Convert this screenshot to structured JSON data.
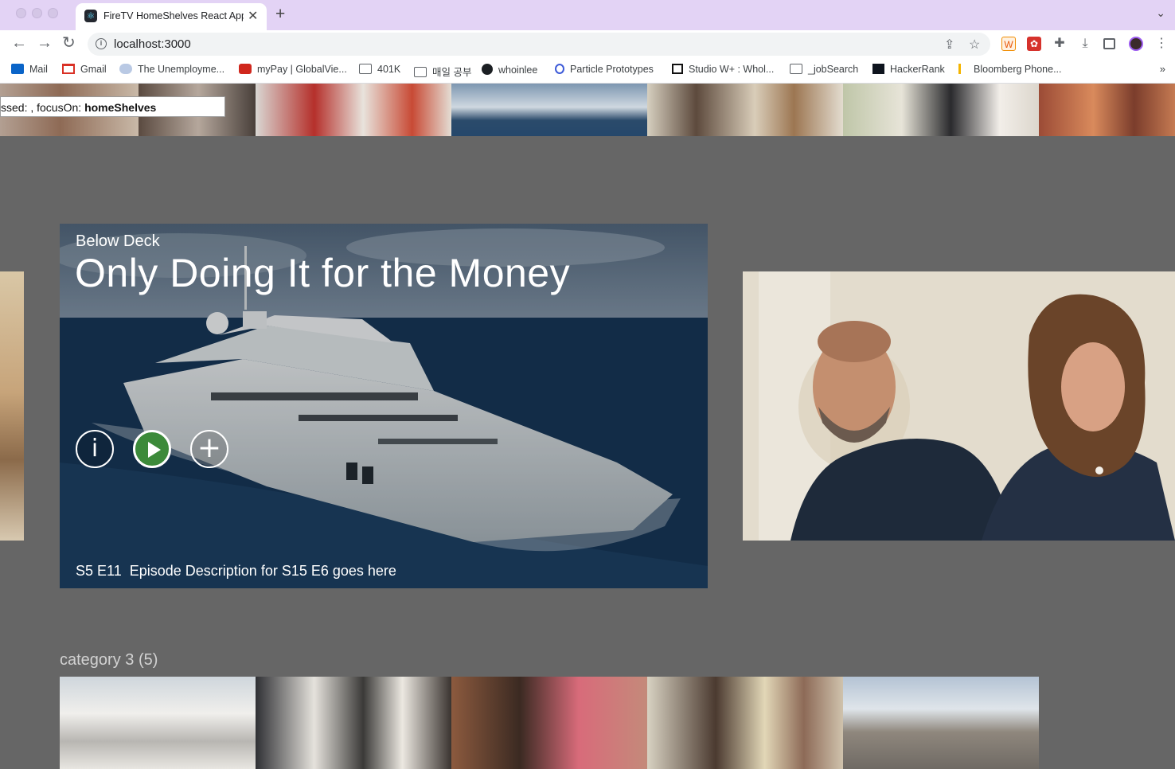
{
  "browser": {
    "tab_title": "FireTV HomeShelves React App",
    "url": "localhost:3000",
    "bookmarks": [
      {
        "label": "Mail",
        "icon": "outlook-icon"
      },
      {
        "label": "Gmail",
        "icon": "gmail-icon"
      },
      {
        "label": "The Unemployme...",
        "icon": "cloud-icon"
      },
      {
        "label": "myPay | GlobalVie...",
        "icon": "adp-icon"
      },
      {
        "label": "401K",
        "icon": "folder-icon"
      },
      {
        "label": "매일 공부",
        "icon": "folder-icon"
      },
      {
        "label": "whoinlee",
        "icon": "github-icon"
      },
      {
        "label": "Particle Prototypes",
        "icon": "particle-icon"
      },
      {
        "label": "Studio W+ : Whol...",
        "icon": "studio-icon"
      },
      {
        "label": "_jobSearch",
        "icon": "folder-icon"
      },
      {
        "label": "HackerRank",
        "icon": "hackerrank-icon"
      },
      {
        "label": "Bloomberg Phone...",
        "icon": "bloomberg-icon"
      }
    ],
    "more_bookmarks": "»"
  },
  "status": {
    "prefix": "ssed: , focusOn: ",
    "focus_value": "homeShelves"
  },
  "hero": {
    "show_name": "Below Deck",
    "episode_title": "Only Doing It for the Money",
    "episode_code": "S5 E11",
    "description": "Episode Description for S15 E6 goes here",
    "info_glyph": "i",
    "add_glyph": "+"
  },
  "category": {
    "title": "category 3 (5)"
  },
  "colors": {
    "page_bg": "#666666",
    "tab_strip": "#e3d3f5",
    "play_button": "#3c8a3a"
  }
}
